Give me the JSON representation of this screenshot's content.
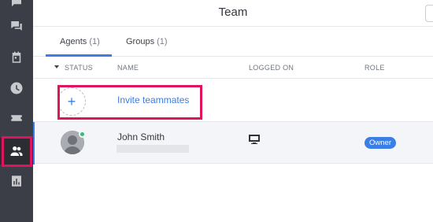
{
  "header": {
    "title": "Team"
  },
  "tabs": [
    {
      "label": "Agents",
      "count": "(1)"
    },
    {
      "label": "Groups",
      "count": "(1)"
    }
  ],
  "columns": {
    "status": "STATUS",
    "name": "NAME",
    "logged_on": "LOGGED ON",
    "role": "ROLE"
  },
  "invite": {
    "label": "Invite teammates",
    "icon": "+"
  },
  "members": [
    {
      "name": "John Smith",
      "role": "Owner",
      "status": "online",
      "device": "desktop-monitor-icon"
    }
  ],
  "sidebar": {
    "items": [
      {
        "icon": "chat-bubble-icon"
      },
      {
        "icon": "chats-icon"
      },
      {
        "icon": "tickets-icon"
      },
      {
        "icon": "history-clock-icon"
      },
      {
        "icon": "archive-ticket-icon"
      },
      {
        "icon": "team-users-icon",
        "active": true
      },
      {
        "icon": "reports-chart-icon"
      }
    ]
  },
  "colors": {
    "accent": "#3a7ee6",
    "highlight": "#e0145e",
    "online": "#3cb878",
    "sidebar": "#3b3e46"
  }
}
